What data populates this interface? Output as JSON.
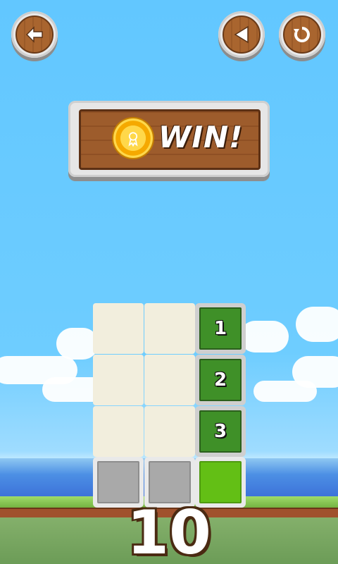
{
  "buttons": {
    "back_icon": "arrow-left-icon",
    "prev_icon": "triangle-left-icon",
    "restart_icon": "refresh-icon"
  },
  "banner": {
    "text": "WIN!",
    "medal_icon": "medal-icon"
  },
  "grid": {
    "numbers": [
      "1",
      "2",
      "3"
    ]
  },
  "level": "10",
  "colors": {
    "tile_green": "#3f9028",
    "base_green": "#63bf15",
    "empty_tile": "#f2eedd",
    "wood": "#9d5c2c"
  }
}
